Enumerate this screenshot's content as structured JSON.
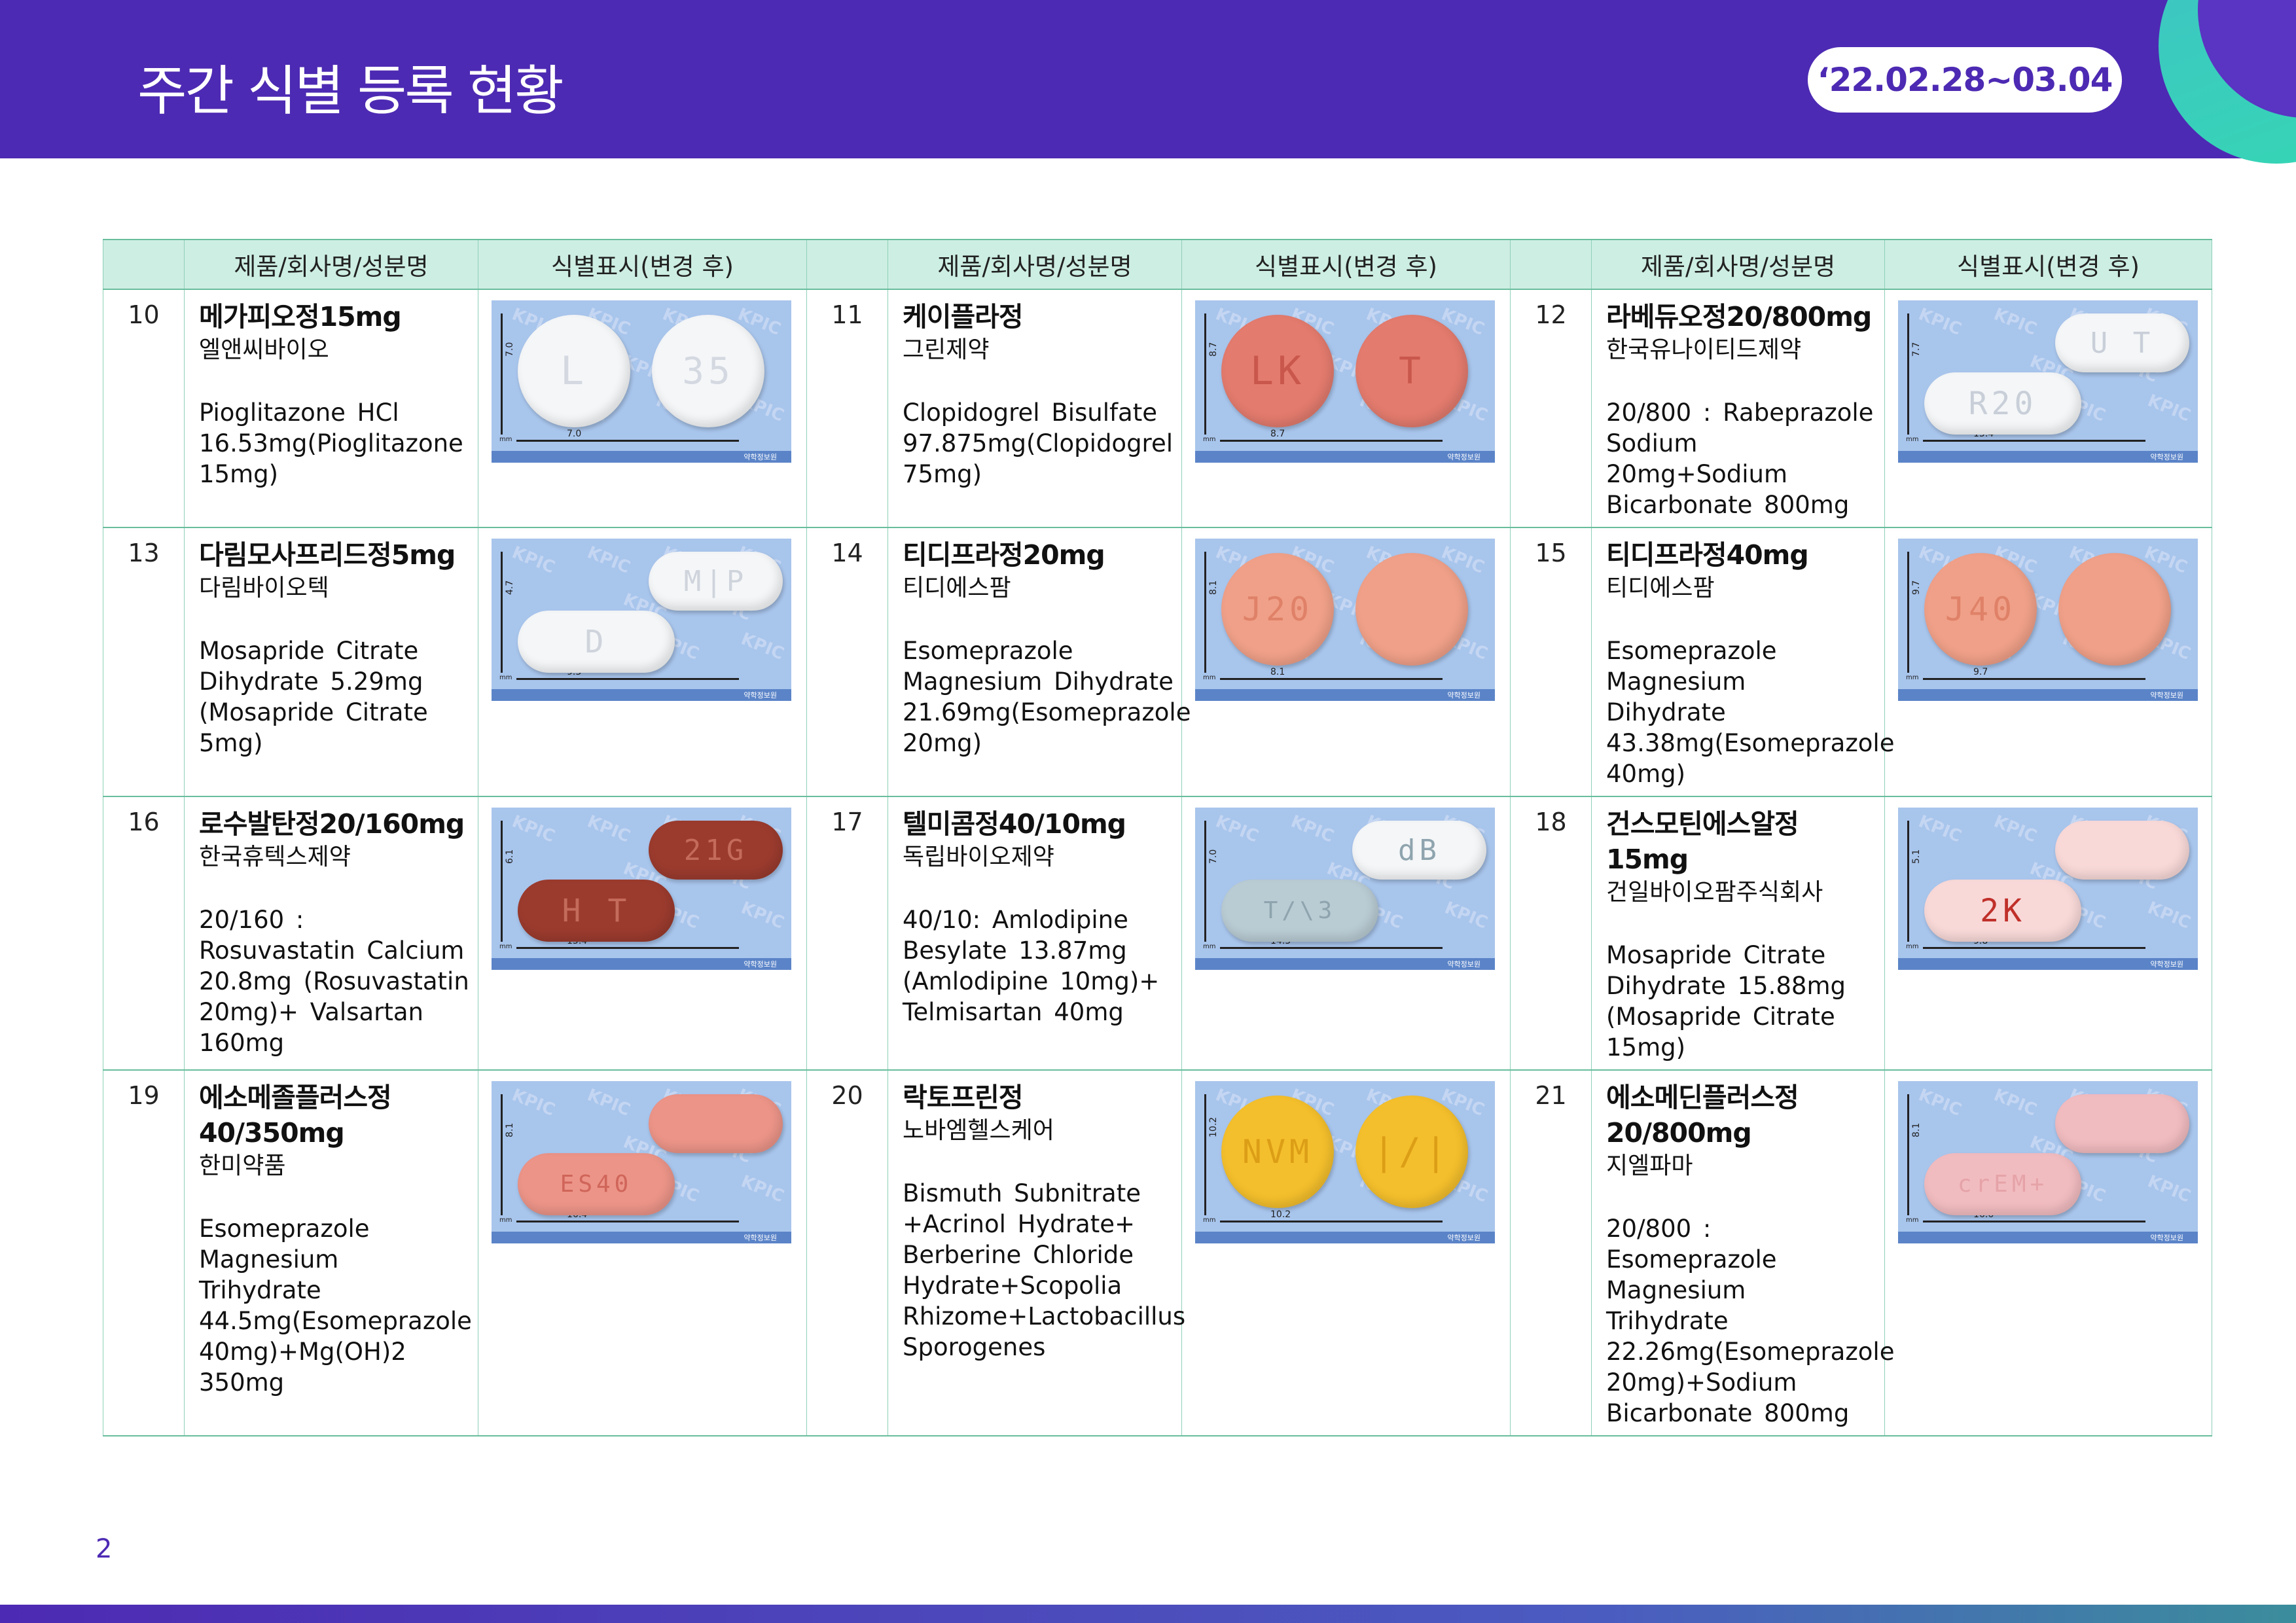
{
  "header": {
    "title": "주간 식별 등록 현황",
    "date_range": "‘22.02.28~03.04"
  },
  "table": {
    "col_product": "제품/회사명/성분명",
    "col_marking": "식별표시(변경 후)",
    "rows": [
      [
        {
          "no": "10",
          "name": "메가피오정15mg",
          "company": "엘앤씨바이오",
          "comp": "Pioglitazone HCl 16.53mg(Pioglitazone 15mg)",
          "img": {
            "w": "7.0",
            "h": "7.0",
            "shape": "round",
            "color": "#f4f6f8",
            "text": "#d4d9e1",
            "m1": "L",
            "m2": "35"
          }
        },
        {
          "no": "11",
          "name": "케이플라정",
          "company": "그린제약",
          "comp": "Clopidogrel Bisulfate 97.875mg(Clopidogrel 75mg)",
          "img": {
            "w": "8.7",
            "h": "8.7",
            "shape": "round",
            "color": "#e37b6e",
            "text": "#c9574c",
            "m1": "LK",
            "m2": "T"
          }
        },
        {
          "no": "12",
          "name": "라베듀오정20/800mg",
          "company": "한국유나이티드제약",
          "comp": "20/800 : Rabeprazole Sodium 20mg+Sodium Bicarbonate 800mg",
          "img": {
            "w": "15.4",
            "h": "7.7",
            "shape": "oval",
            "color": "#f4f6f8",
            "text": "#c9cfd8",
            "m1": "R20",
            "m2": "U T"
          }
        }
      ],
      [
        {
          "no": "13",
          "name": "다림모사프리드정5mg",
          "company": "다림바이오텍",
          "comp": "Mosapride Citrate Dihydrate 5.29mg (Mosapride Citrate 5mg)",
          "img": {
            "w": "9.3",
            "h": "4.7",
            "shape": "oval",
            "color": "#f4f6f8",
            "text": "#cfd4dc",
            "m1": "D",
            "m2": "M|P"
          }
        },
        {
          "no": "14",
          "name": "티디프라정20mg",
          "company": "티디에스팜",
          "comp": "Esomeprazole Magnesium Dihydrate 21.69mg(Esomeprazole 20mg)",
          "img": {
            "w": "8.1",
            "h": "8.1",
            "shape": "round",
            "color": "#f0a088",
            "text": "#df8168",
            "m1": "J20",
            "m2": ""
          }
        },
        {
          "no": "15",
          "name": "티디프라정40mg",
          "company": "티디에스팜",
          "comp": "Esomeprazole Magnesium Dihydrate 43.38mg(Esomeprazole 40mg)",
          "img": {
            "w": "9.7",
            "h": "9.7",
            "shape": "round",
            "color": "#f0a088",
            "text": "#df8168",
            "m1": "J40",
            "m2": ""
          }
        }
      ],
      [
        {
          "no": "16",
          "name": "로수발탄정20/160mg",
          "company": "한국휴텍스제약",
          "comp": "20/160 : Rosuvastatin Calcium 20.8mg (Rosuvastatin 20mg)+ Valsartan 160mg",
          "img": {
            "w": "15.4",
            "h": "6.1",
            "shape": "oval",
            "color": "#9b3b2e",
            "text": "#c46b5b",
            "m1": "H T",
            "m2": "21G"
          }
        },
        {
          "no": "17",
          "name": "텔미콤정40/10mg",
          "company": "독립바이오제약",
          "comp": "40/10: Amlodipine Besylate 13.87mg (Amlodipine 10mg)+ Telmisartan 40mg",
          "img": {
            "w": "14.3",
            "h": "7.0",
            "shape": "oval",
            "color": "#b9cbd3",
            "text": "#8ea4ae",
            "m1": "T/\\3",
            "m2": "dB",
            "c2": "#f4f6f8"
          }
        },
        {
          "no": "18",
          "name": "건스모틴에스알정15mg",
          "company": "건일바이오팜주식회사",
          "comp": "Mosapride Citrate Dihydrate 15.88mg (Mosapride Citrate 15mg)",
          "img": {
            "w": "9.8",
            "h": "5.1",
            "shape": "oval",
            "color": "#f8d9d8",
            "text": "#c0302a",
            "m1": "2K",
            "m2": ""
          }
        }
      ],
      [
        {
          "no": "19",
          "name": "에소메졸플러스정40/350mg",
          "company": "한미약품",
          "comp": "Esomeprazole Magnesium Trihydrate 44.5mg(Esomeprazole 40mg)+Mg(OH)2 350mg",
          "img": {
            "w": "16.4",
            "h": "8.1",
            "shape": "oval",
            "color": "#ec9488",
            "text": "#d0655a",
            "m1": "ES40",
            "m2": ""
          }
        },
        {
          "no": "20",
          "name": "락토프린정",
          "company": "노바엠헬스케어",
          "comp": "Bismuth Subnitrate +Acrinol Hydrate+ Berberine Chloride Hydrate+Scopolia Rhizome+Lactobacillus Sporogenes",
          "img": {
            "w": "10.2",
            "h": "10.2",
            "shape": "round",
            "color": "#f4bf2c",
            "text": "#dc9e16",
            "m1": "NVM",
            "m2": "|/|"
          }
        },
        {
          "no": "21",
          "name": "에소메딘플러스정20/800mg",
          "company": "지엘파마",
          "comp": "20/800 : Esomeprazole Magnesium Trihydrate 22.26mg(Esomeprazole 20mg)+Sodium Bicarbonate 800mg",
          "img": {
            "w": "16.6",
            "h": "8.1",
            "shape": "oval",
            "color": "#f1bcc0",
            "text": "#e5a3a8",
            "m1": "crEM+",
            "m2": ""
          }
        }
      ]
    ]
  },
  "photo_footer": "약학정보원",
  "watermark": "KPIC",
  "page_number": "2"
}
